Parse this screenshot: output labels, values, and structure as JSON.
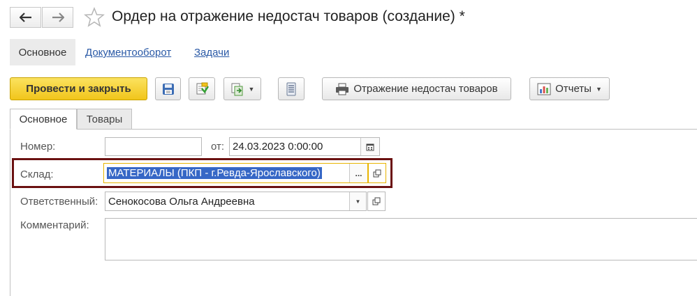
{
  "nav": {
    "back_icon": "arrow-left-icon",
    "forward_icon": "arrow-right-icon",
    "favorite_icon": "star-icon"
  },
  "window": {
    "title": "Ордер на отражение недостач товаров (создание) *"
  },
  "top_tabs": [
    {
      "label": "Основное",
      "active": true
    },
    {
      "label": "Документооборот",
      "active": false
    },
    {
      "label": "Задачи",
      "active": false
    }
  ],
  "toolbar": {
    "post_close_label": "Провести и закрыть",
    "print_label": "Отражение недостач товаров",
    "reports_label": "Отчеты"
  },
  "form_tabs": [
    {
      "label": "Основное",
      "active": true
    },
    {
      "label": "Товары",
      "active": false
    }
  ],
  "form": {
    "number_label": "Номер:",
    "number_value": "",
    "date_label": "от:",
    "date_value": "24.03.2023  0:00:00",
    "warehouse_label": "Склад:",
    "warehouse_value": "МАТЕРИАЛЫ (ПКП - г.Ревда-Ярославского)",
    "warehouse_dots": "...",
    "responsible_label": "Ответственный:",
    "responsible_value": "Сенокосова Ольга Андреевна",
    "comment_label": "Комментарий:",
    "comment_value": ""
  },
  "colors": {
    "accent_yellow": "#f1c51b",
    "link_blue": "#2a59a6",
    "highlight_frame": "#6b1111",
    "selection": "#3667c6"
  }
}
